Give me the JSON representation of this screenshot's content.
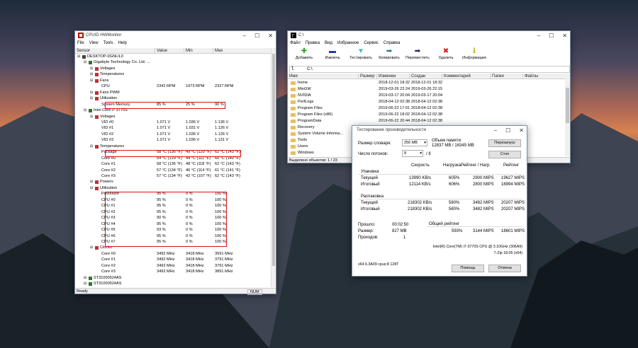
{
  "hwm": {
    "title": "CPUID HWMonitor",
    "menu": [
      "File",
      "View",
      "Tools",
      "Help"
    ],
    "cols": [
      "Sensor",
      "Value",
      "Min",
      "Max"
    ],
    "rows": [
      {
        "t": "DESKTOP-0GNLIL0",
        "v": "",
        "mi": "",
        "ma": "",
        "l": 0
      },
      {
        "t": "Gigabyte Technology Co. Ltd. ...",
        "v": "",
        "mi": "",
        "ma": "",
        "l": 1
      },
      {
        "t": "Voltages",
        "v": "",
        "mi": "",
        "ma": "",
        "l": 2
      },
      {
        "t": "Temperatures",
        "v": "",
        "mi": "",
        "ma": "",
        "l": 2
      },
      {
        "t": "Fans",
        "v": "",
        "mi": "",
        "ma": "",
        "l": 2
      },
      {
        "t": "CPU",
        "v": "2342 RPM",
        "mi": "1973 RPM",
        "ma": "2327 RPM",
        "l": 3
      },
      {
        "t": "Fans PWM",
        "v": "",
        "mi": "",
        "ma": "",
        "l": 2
      },
      {
        "t": "Utilization",
        "v": "",
        "mi": "",
        "ma": "",
        "l": 2
      },
      {
        "t": "System Memory",
        "v": "85 %",
        "mi": "25 %",
        "ma": "90 %",
        "l": 3
      },
      {
        "t": "Intel Core i7 3770S",
        "v": "",
        "mi": "",
        "ma": "",
        "l": 1
      },
      {
        "t": "Voltages",
        "v": "",
        "mi": "",
        "ma": "",
        "l": 2
      },
      {
        "t": "VID #0",
        "v": "1.071 V",
        "mi": "1.036 V",
        "ma": "1.136 V",
        "l": 3
      },
      {
        "t": "VID #1",
        "v": "1.071 V",
        "mi": "1.031 V",
        "ma": "1.126 V",
        "l": 3
      },
      {
        "t": "VID #2",
        "v": "1.071 V",
        "mi": "1.036 V",
        "ma": "1.126 V",
        "l": 3
      },
      {
        "t": "VID #3",
        "v": "1.071 V",
        "mi": "1.036 V",
        "ma": "1.131 V",
        "l": 3
      },
      {
        "t": "Temperatures",
        "v": "",
        "mi": "",
        "ma": "",
        "l": 2
      },
      {
        "t": "Package",
        "v": "58 °C  (136 °F)",
        "mi": "49 °C  (120 °F)",
        "ma": "62 °C  (143 °F)",
        "l": 3
      },
      {
        "t": "Core #0",
        "v": "54 °C  (129 °F)",
        "mi": "44 °C  (111 °F)",
        "ma": "60 °C  (140 °F)",
        "l": 3
      },
      {
        "t": "Core #1",
        "v": "58 °C  (136 °F)",
        "mi": "48 °C  (118 °F)",
        "ma": "62 °C  (143 °F)",
        "l": 3
      },
      {
        "t": "Core #2",
        "v": "57 °C  (134 °F)",
        "mi": "46 °C  (114 °F)",
        "ma": "61 °C  (141 °F)",
        "l": 3
      },
      {
        "t": "Core #3",
        "v": "57 °C  (134 °F)",
        "mi": "42 °C  (107 °F)",
        "ma": "62 °C  (143 °F)",
        "l": 3
      },
      {
        "t": "Powers",
        "v": "",
        "mi": "",
        "ma": "",
        "l": 2
      },
      {
        "t": "Utilization",
        "v": "",
        "mi": "",
        "ma": "",
        "l": 2
      },
      {
        "t": "Processor",
        "v": "95 %",
        "mi": "0 %",
        "ma": "100 %",
        "l": 3
      },
      {
        "t": "CPU #0",
        "v": "95 %",
        "mi": "0 %",
        "ma": "100 %",
        "l": 3
      },
      {
        "t": "CPU #1",
        "v": "95 %",
        "mi": "0 %",
        "ma": "100 %",
        "l": 3
      },
      {
        "t": "CPU #2",
        "v": "95 %",
        "mi": "0 %",
        "ma": "100 %",
        "l": 3
      },
      {
        "t": "CPU #3",
        "v": "90 %",
        "mi": "0 %",
        "ma": "100 %",
        "l": 3
      },
      {
        "t": "CPU #4",
        "v": "95 %",
        "mi": "0 %",
        "ma": "100 %",
        "l": 3
      },
      {
        "t": "CPU #5",
        "v": "93 %",
        "mi": "0 %",
        "ma": "100 %",
        "l": 3
      },
      {
        "t": "CPU #6",
        "v": "95 %",
        "mi": "0 %",
        "ma": "100 %",
        "l": 3
      },
      {
        "t": "CPU #7",
        "v": "95 %",
        "mi": "0 %",
        "ma": "100 %",
        "l": 3
      },
      {
        "t": "Clocks",
        "v": "",
        "mi": "",
        "ma": "",
        "l": 2
      },
      {
        "t": "Core #0",
        "v": "3492 MHz",
        "mi": "3418 MHz",
        "ma": "3591 MHz",
        "l": 3
      },
      {
        "t": "Core #1",
        "v": "3492 MHz",
        "mi": "3418 MHz",
        "ma": "3791 MHz",
        "l": 3
      },
      {
        "t": "Core #2",
        "v": "3492 MHz",
        "mi": "3418 MHz",
        "ma": "3791 MHz",
        "l": 3
      },
      {
        "t": "Core #3",
        "v": "3492 MHz",
        "mi": "3418 MHz",
        "ma": "3891 MHz",
        "l": 3
      },
      {
        "t": "ST31000524AS",
        "v": "",
        "mi": "",
        "ma": "",
        "l": 1
      },
      {
        "t": "ST31000524AS",
        "v": "",
        "mi": "",
        "ma": "",
        "l": 1
      }
    ],
    "status": "Ready",
    "num": "NUM"
  },
  "fm": {
    "title": "C:\\",
    "menu": [
      "Файл",
      "Правка",
      "Вид",
      "Избранное",
      "Сервис",
      "Справка"
    ],
    "tools": [
      {
        "label": "Добавить",
        "g": "✚",
        "c": "#2aa02a"
      },
      {
        "label": "Извлечь",
        "g": "▬",
        "c": "#2040a0"
      },
      {
        "label": "Тестировать",
        "g": "▼",
        "c": "#40c0c0"
      },
      {
        "label": "Копировать",
        "g": "➡",
        "c": "#208060"
      },
      {
        "label": "Переместить",
        "g": "➡",
        "c": "#202060"
      },
      {
        "label": "Удалить",
        "g": "✖",
        "c": "#d02020"
      },
      {
        "label": "Информация",
        "g": "ℹ",
        "c": "#c0a000"
      }
    ],
    "path": "C:\\",
    "cols": [
      "Имя",
      "Размер",
      "Изменен",
      "Создан",
      "Комментарий",
      "Папки",
      "Файлы"
    ],
    "files": [
      {
        "n": "home",
        "m": "2018-12-01 18:32",
        "c": "2018-12-01 18:32"
      },
      {
        "n": "MinGW",
        "m": "2019-03-26 22:24",
        "c": "2019-03-26 22:15"
      },
      {
        "n": "NVIDIA",
        "m": "2019-03-17 20:04",
        "c": "2019-03-17 20:04"
      },
      {
        "n": "PerfLogs",
        "m": "2018-04-12 02:38",
        "c": "2018-04-12 02:38"
      },
      {
        "n": "Program Files",
        "m": "2019-06-22 17:01",
        "c": "2018-04-12 02:38"
      },
      {
        "n": "Program Files (x86)",
        "m": "2019-06-22 18:02",
        "c": "2018-04-12 02:38"
      },
      {
        "n": "ProgramData",
        "m": "2019-06-22 20:44",
        "c": "2018-04-12 02:38"
      },
      {
        "n": "Recovery",
        "m": "",
        "c": ""
      },
      {
        "n": "System Volume Informa...",
        "m": "",
        "c": ""
      },
      {
        "n": "Tools",
        "m": "",
        "c": ""
      },
      {
        "n": "Users",
        "m": "",
        "c": ""
      },
      {
        "n": "Windows",
        "m": "",
        "c": ""
      }
    ],
    "status": "Выделено объектов: 1 / 23"
  },
  "bench": {
    "title": "Тестирование производительности",
    "dict_label": "Размер словаря:",
    "dict_val": "256 MB",
    "mem_label": "Объем памяти:",
    "mem_val": "12837 MB / 16345 MB",
    "threads_label": "Число потоков:",
    "threads_val": "8",
    "threads_tot": "/ 8",
    "restart": "Перезапуск",
    "stop": "Стоп",
    "hdr": [
      "Скорость",
      "Нагрузка",
      "Рейтинг / Нагр.",
      "Рейтинг"
    ],
    "pack": "Упаковка",
    "unpack": "Распаковка",
    "cur": "Текущий",
    "tot": "Итоговый",
    "pack_cur": [
      "13990 KB/s",
      "605%",
      "2900 MIPS",
      "19627 MIPS"
    ],
    "pack_tot": [
      "12114 KB/s",
      "606%",
      "2800 MIPS",
      "16994 MIPS"
    ],
    "unp_cur": [
      "218302 KB/s",
      "580%",
      "3482 MIPS",
      "20207 MIPS"
    ],
    "unp_tot": [
      "218302 KB/s",
      "580%",
      "3482 MIPS",
      "20207 MIPS"
    ],
    "elapsed_l": "Прошло:",
    "elapsed": "00:02:50",
    "size_l": "Размер:",
    "size": "827 MB",
    "passes_l": "Проходов:",
    "passes": "1",
    "overall": "Общий рейтинг",
    "ov": [
      "593%",
      "3144 MIPS",
      "18601 MIPS"
    ],
    "cpu": "Intel(R) Core(TM) i7-3770S CPU @ 3.10GHz (306A9)",
    "ver": "7-Zip 18.05 (x64)",
    "sys": "x64 6.3A09 cpus:8 128T",
    "help": "Помощь",
    "cancel": "Отмена"
  }
}
